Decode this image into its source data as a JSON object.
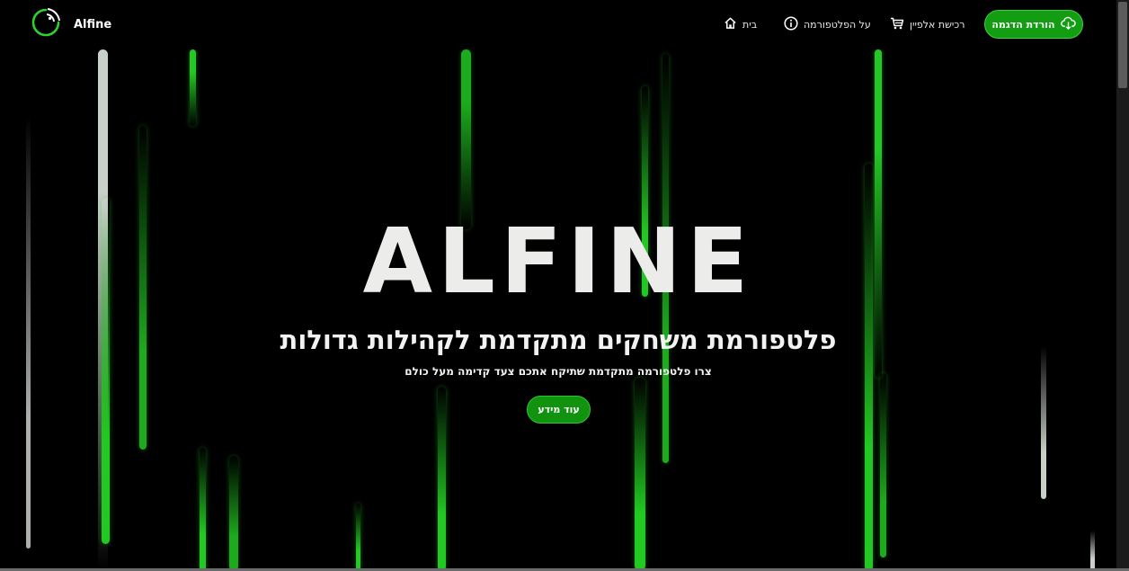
{
  "brand": {
    "name": "Alfine"
  },
  "nav": {
    "items": [
      {
        "label": "בית",
        "icon": "home-icon"
      },
      {
        "label": "על הפלטפורמה",
        "icon": "info-icon"
      },
      {
        "label": "רכישת אלפיין",
        "icon": "cart-icon"
      }
    ],
    "download": {
      "label": "הורדת הדגמה",
      "icon": "cloud-download-icon"
    }
  },
  "hero": {
    "title": "ALFINE",
    "subtitle": "פלטפורמת משחקים מתקדמת לקהילות גדולות",
    "description": "צרו פלטפורמה מתקדמת שתיקח אתכם צעד קדימה מעל כולם",
    "cta_label": "עוד מידע"
  },
  "colors": {
    "background": "#000000",
    "accent": "#129d12",
    "accent_border": "#3ad33a",
    "title_text": "#ececea",
    "streak_green": "#22c922",
    "streak_gray": "#c9cfc9"
  }
}
